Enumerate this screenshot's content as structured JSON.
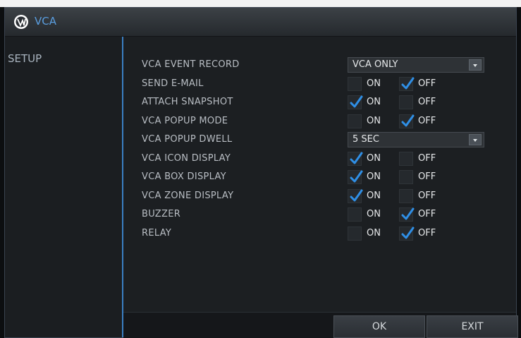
{
  "window": {
    "title": "VCA"
  },
  "sidebar": {
    "selected": "SETUP"
  },
  "settings": [
    {
      "label": "VCA EVENT RECORD",
      "type": "dropdown",
      "value": "VCA ONLY"
    },
    {
      "label": "SEND E-MAIL",
      "type": "onoff",
      "on_label": "ON",
      "off_label": "OFF",
      "checked": "off"
    },
    {
      "label": "ATTACH SNAPSHOT",
      "type": "onoff",
      "on_label": "ON",
      "off_label": "OFF",
      "checked": "on"
    },
    {
      "label": "VCA POPUP MODE",
      "type": "onoff",
      "on_label": "ON",
      "off_label": "OFF",
      "checked": "off"
    },
    {
      "label": "VCA POPUP DWELL",
      "type": "dropdown",
      "value": "5 SEC"
    },
    {
      "label": "VCA ICON DISPLAY",
      "type": "onoff",
      "on_label": "ON",
      "off_label": "OFF",
      "checked": "on"
    },
    {
      "label": "VCA BOX DISPLAY",
      "type": "onoff",
      "on_label": "ON",
      "off_label": "OFF",
      "checked": "on"
    },
    {
      "label": "VCA ZONE DISPLAY",
      "type": "onoff",
      "on_label": "ON",
      "off_label": "OFF",
      "checked": "on"
    },
    {
      "label": "BUZZER",
      "type": "onoff",
      "on_label": "ON",
      "off_label": "OFF",
      "checked": "off"
    },
    {
      "label": "RELAY",
      "type": "onoff",
      "on_label": "ON",
      "off_label": "OFF",
      "checked": "off"
    }
  ],
  "footer": {
    "ok_label": "OK",
    "exit_label": "EXIT"
  },
  "colors": {
    "accent": "#3b7fc2",
    "check": "#2f8fe6",
    "title": "#5a9ee0"
  }
}
